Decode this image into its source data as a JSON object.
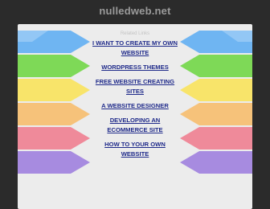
{
  "site": {
    "domain": "nulledweb.net"
  },
  "links_header": "Related Links",
  "links": [
    {
      "label": "I WANT TO CREATE MY OWN WEBSITE"
    },
    {
      "label": "WORDPRESS THEMES"
    },
    {
      "label": "FREE WEBSITE CREATING SITES"
    },
    {
      "label": "A WEBSITE DESIGNER"
    },
    {
      "label": "DEVELOPING AN ECOMMERCE SITE"
    },
    {
      "label": "HOW TO YOUR OWN WEBSITE"
    }
  ],
  "colors": {
    "background": "#2b2b2b",
    "panel": "#ececec",
    "link": "#1f2a8a",
    "ribbon_blue": "#6fb5f2",
    "ribbon_green": "#7ed957",
    "ribbon_yellow": "#f8e46a",
    "ribbon_orange": "#f6c27a",
    "ribbon_pink": "#ef8a9a",
    "ribbon_purple": "#a78be0"
  }
}
